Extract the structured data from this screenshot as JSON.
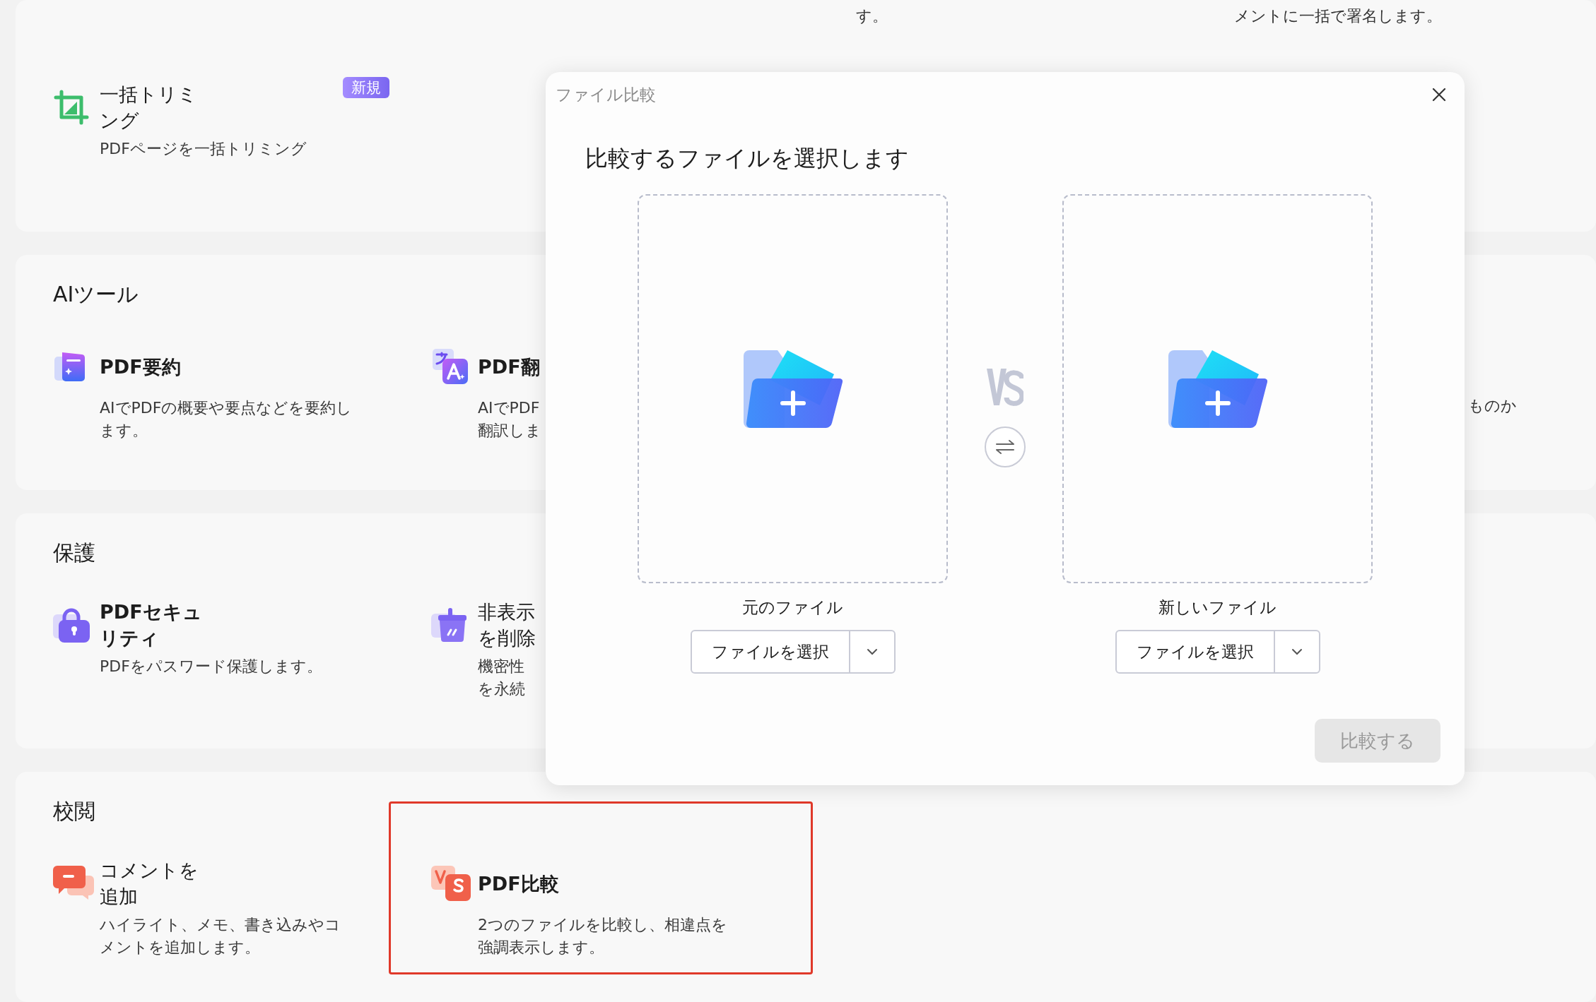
{
  "top_section": {
    "fragments": [
      "す。",
      "メントに一括で署名します。"
    ],
    "items": [
      {
        "title_lines": [
          "一括トリミ",
          "ング"
        ],
        "description_lines": [
          "PDFページを一括トリミング"
        ],
        "badge": "新規"
      }
    ]
  },
  "sections": [
    {
      "title": "AIツール",
      "items": [
        {
          "title_lines": [
            "PDF要約"
          ],
          "description_lines": [
            "AIでPDFの概要や要点などを要約し",
            "ます。"
          ],
          "selected": false
        },
        {
          "title_lines": [
            "PDF翻"
          ],
          "description_lines": [
            "AIでPDF",
            "翻訳しま"
          ],
          "selected": false
        }
      ],
      "fragments": [
        "ものか"
      ]
    },
    {
      "title": "保護",
      "items": [
        {
          "title_lines": [
            "PDFセキュ",
            "リティ"
          ],
          "description_lines": [
            "PDFをパスワード保護します。"
          ],
          "selected": false
        },
        {
          "title_lines": [
            "非表示",
            "を削除"
          ],
          "description_lines": [
            "機密性",
            "を永続"
          ],
          "selected": false
        }
      ]
    },
    {
      "title": "校閲",
      "items": [
        {
          "title_lines": [
            "コメントを",
            "追加"
          ],
          "description_lines": [
            "ハイライト、メモ、書き込みやコ",
            "メントを追加します。"
          ],
          "selected": false
        },
        {
          "title_lines": [
            "PDF比較"
          ],
          "description_lines": [
            "2つのファイルを比較し、相違点を",
            "強調表示します。"
          ],
          "selected": true
        }
      ]
    }
  ],
  "dialog": {
    "title": "ファイル比較",
    "heading": "比較するファイルを選択します",
    "files": [
      {
        "label": "元のファイル",
        "button": "ファイルを選択"
      },
      {
        "label": "新しいファイル",
        "button": "ファイルを選択"
      }
    ],
    "compare_button": {
      "label": "比較する",
      "disabled": true
    }
  }
}
